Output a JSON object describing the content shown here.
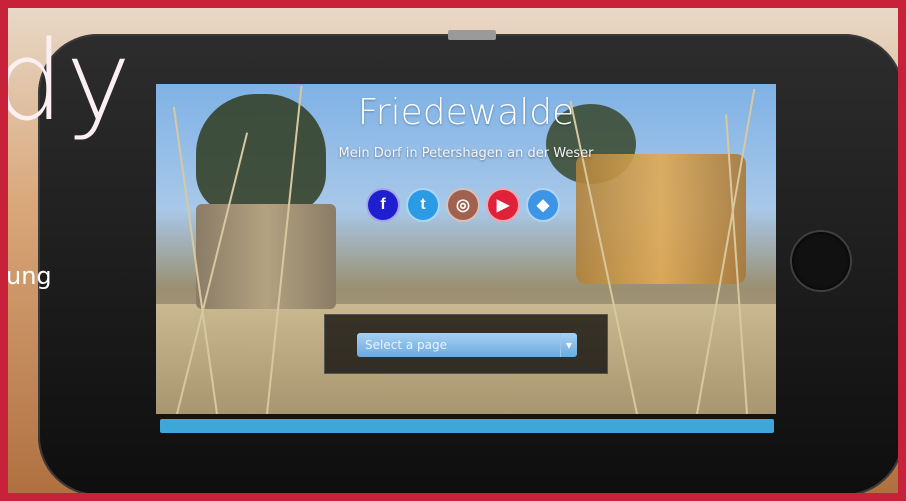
{
  "overlay": {
    "bg_word": "dy",
    "bg_fragment": "ung"
  },
  "site": {
    "title": "Friedewalde",
    "subtitle": "Mein Dorf in Petershagen an der Weser"
  },
  "social": [
    {
      "icon": "facebook-icon",
      "glyph": "f",
      "color": "#1f1fd0"
    },
    {
      "icon": "twitter-icon",
      "glyph": "t",
      "color": "#2b9be6"
    },
    {
      "icon": "instagram-icon",
      "glyph": "◎",
      "color": "#a0624e"
    },
    {
      "icon": "youtube-icon",
      "glyph": "▶",
      "color": "#e0213a"
    },
    {
      "icon": "dropbox-icon",
      "glyph": "◆",
      "color": "#3d95e6"
    }
  ],
  "dropdown": {
    "placeholder": "Select a page"
  },
  "colors": {
    "frame": "#c8213a",
    "bottom_bar": "#3ea6d8"
  }
}
